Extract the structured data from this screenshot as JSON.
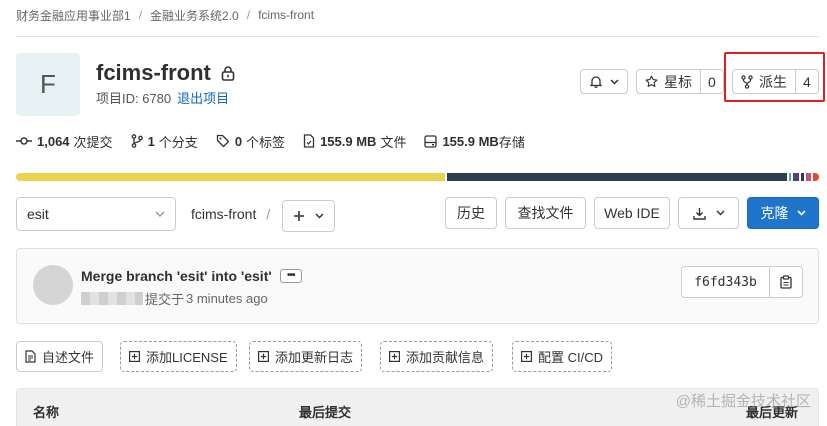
{
  "breadcrumb": [
    "财务金融应用事业部1",
    "金融业务系统2.0",
    "fcims-front"
  ],
  "project": {
    "avatar_letter": "F",
    "name": "fcims-front",
    "id_label": "项目ID: 6780",
    "leave_label": "退出项目"
  },
  "actions": {
    "notification_icon": "bell-icon",
    "star_label": "星标",
    "star_count": "0",
    "fork_label": "派生",
    "fork_count": "4"
  },
  "stats": {
    "commits_count": "1,064",
    "commits_label": "次提交",
    "branches_count": "1",
    "branches_label": "个分支",
    "tags_count": "0",
    "tags_label": "个标签",
    "files_size": "155.9 MB",
    "files_label": "文件",
    "storage_size": "155.9 MB",
    "storage_label": "存储"
  },
  "language_bar": [
    {
      "color": "#e9d44d",
      "share": 0.542
    },
    {
      "color": "#2c3e50",
      "share": 0.43
    },
    {
      "color": "#41b883",
      "share": 0.003
    },
    {
      "color": "#563d7c",
      "share": 0.007
    },
    {
      "color": "#2c3e50",
      "share": 0.004
    },
    {
      "color": "#c6538c",
      "share": 0.007
    },
    {
      "color": "#e44b23",
      "share": 0.007
    }
  ],
  "controls": {
    "branch": "esit",
    "path_root": "fcims-front",
    "path_sep": "/",
    "history_label": "历史",
    "find_file_label": "查找文件",
    "web_ide_label": "Web IDE",
    "clone_label": "克隆"
  },
  "commit": {
    "message": "Merge branch 'esit' into 'esit'",
    "author_suffix": "提交于",
    "time": "3 minutes ago",
    "sha": "f6fd343b"
  },
  "quick_actions": [
    {
      "label": "自述文件",
      "icon": "document-icon",
      "style": "solid"
    },
    {
      "label": "添加LICENSE",
      "icon": "plus-square-icon",
      "style": "dashed"
    },
    {
      "label": "添加更新日志",
      "icon": "plus-square-icon",
      "style": "dashed"
    },
    {
      "label": "添加贡献信息",
      "icon": "plus-square-icon",
      "style": "dashed"
    },
    {
      "label": "配置 CI/CD",
      "icon": "plus-square-icon",
      "style": "dashed"
    }
  ],
  "table": {
    "col_name": "名称",
    "col_last_commit": "最后提交",
    "col_last_update": "最后更新"
  },
  "watermark": "@稀土掘金技术社区"
}
